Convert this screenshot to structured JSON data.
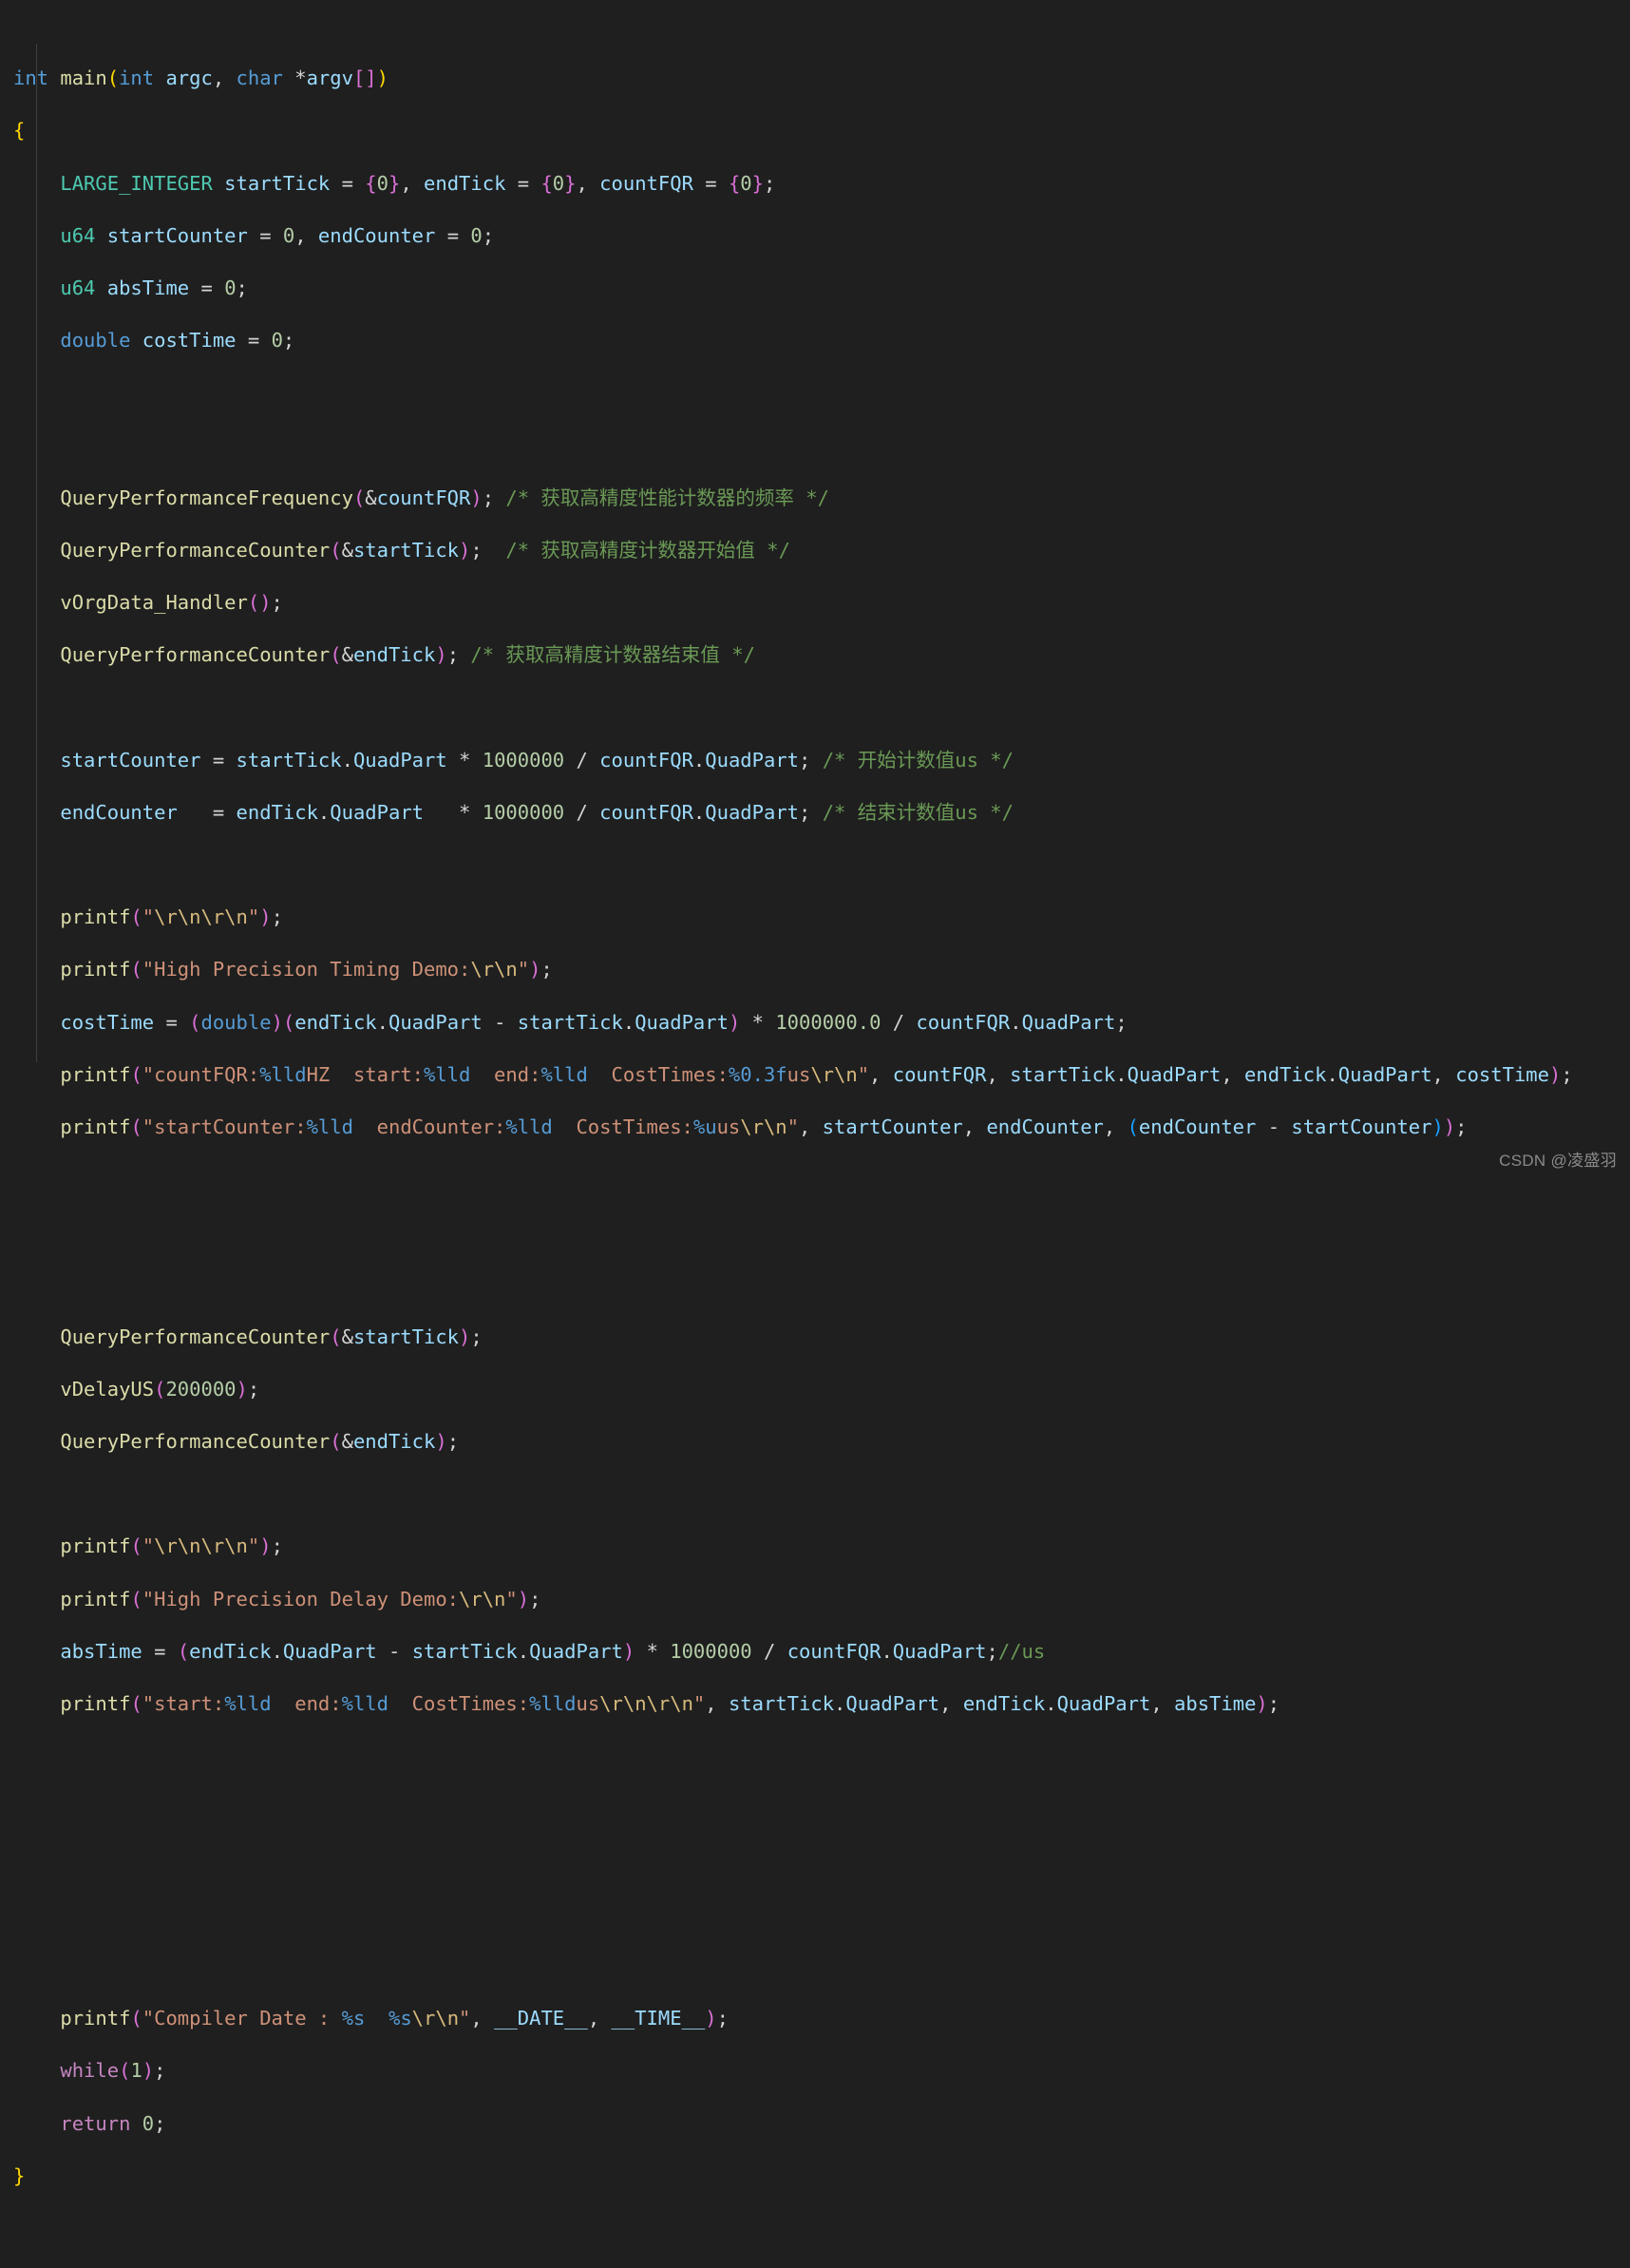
{
  "editor": {
    "language": "c",
    "theme": "dark-plus",
    "background_color": "#1f1f1f",
    "watermark": "CSDN @凌盛羽"
  },
  "colors": {
    "keyword_control": "#c586c0",
    "type": "#569cd6",
    "user_type": "#4ec9b0",
    "function": "#dcdcaa",
    "variable": "#9cdcfe",
    "number": "#b5cea8",
    "string": "#ce9178",
    "escape": "#d7ba7d",
    "comment": "#6a9955",
    "punctuation": "#d4d4d4",
    "bracket_level_1": "#ffd700",
    "bracket_level_2": "#da70d6",
    "bracket_level_3": "#179fff"
  },
  "code": {
    "lines": [
      "int main(int argc, char *argv[])",
      "{",
      "    LARGE_INTEGER startTick = {0}, endTick = {0}, countFQR = {0};",
      "    u64 startCounter = 0, endCounter = 0;",
      "    u64 absTime = 0;",
      "    double costTime = 0;",
      "",
      "",
      "    QueryPerformanceFrequency(&countFQR); /* 获取高精度性能计数器的频率 */",
      "    QueryPerformanceCounter(&startTick);  /* 获取高精度计数器开始值 */",
      "    vOrgData_Handler();",
      "    QueryPerformanceCounter(&endTick); /* 获取高精度计数器结束值 */",
      "",
      "    startCounter = startTick.QuadPart * 1000000 / countFQR.QuadPart; /* 开始计数值us */",
      "    endCounter   = endTick.QuadPart   * 1000000 / countFQR.QuadPart; /* 结束计数值us */",
      "",
      "    printf(\"\\r\\n\\r\\n\");",
      "    printf(\"High Precision Timing Demo:\\r\\n\");",
      "    costTime = (double)(endTick.QuadPart - startTick.QuadPart) * 1000000.0 / countFQR.QuadPart;",
      "    printf(\"countFQR:%lldHZ  start:%lld  end:%lld  CostTimes:%0.3fus\\r\\n\", countFQR, startTick.QuadPart, endTick.QuadPart, costTime);",
      "    printf(\"startCounter:%lld  endCounter:%lld  CostTimes:%uus\\r\\n\", startCounter, endCounter, (endCounter - startCounter));",
      "",
      "",
      "",
      "    QueryPerformanceCounter(&startTick);",
      "    vDelayUS(200000);",
      "    QueryPerformanceCounter(&endTick);",
      "",
      "    printf(\"\\r\\n\\r\\n\");",
      "    printf(\"High Precision Delay Demo:\\r\\n\");",
      "    absTime = (endTick.QuadPart - startTick.QuadPart) * 1000000 / countFQR.QuadPart;//us",
      "    printf(\"start:%lld  end:%lld  CostTimes:%lldus\\r\\n\\r\\n\", startTick.QuadPart, endTick.QuadPart, absTime);",
      "",
      "",
      "",
      "",
      "",
      "    printf(\"Compiler Date : %s  %s\\r\\n\", __DATE__, __TIME__);",
      "    while(1);",
      "    return 0;",
      "}"
    ],
    "comments": {
      "frequency": "/* 获取高精度性能计数器的频率 */",
      "start_value": "/* 获取高精度计数器开始值 */",
      "end_value": "/* 获取高精度计数器结束值 */",
      "start_count_us": "/* 开始计数值us */",
      "end_count_us": "/* 结束计数值us */",
      "us_inline": "//us"
    },
    "strings": {
      "crlf_crlf": "\"\\r\\n\\r\\n\"",
      "timing_demo": "\"High Precision Timing Demo:\\r\\n\"",
      "delay_demo": "\"High Precision Delay Demo:\\r\\n\"",
      "count_fqr_fmt": "\"countFQR:%lldHZ  start:%lld  end:%lld  CostTimes:%0.3fus\\r\\n\"",
      "counter_fmt": "\"startCounter:%lld  endCounter:%lld  CostTimes:%uus\\r\\n\"",
      "abs_time_fmt": "\"start:%lld  end:%lld  CostTimes:%lldus\\r\\n\\r\\n\"",
      "compiler_date_fmt": "\"Compiler Date : %s  %s\\r\\n\""
    },
    "identifiers": [
      "main",
      "argc",
      "argv",
      "LARGE_INTEGER",
      "startTick",
      "endTick",
      "countFQR",
      "u64",
      "startCounter",
      "endCounter",
      "absTime",
      "double",
      "costTime",
      "QueryPerformanceFrequency",
      "QueryPerformanceCounter",
      "vOrgData_Handler",
      "QuadPart",
      "printf",
      "vDelayUS",
      "__DATE__",
      "__TIME__"
    ],
    "numbers": [
      "0",
      "1000000",
      "1000000.0",
      "200000",
      "1"
    ]
  }
}
